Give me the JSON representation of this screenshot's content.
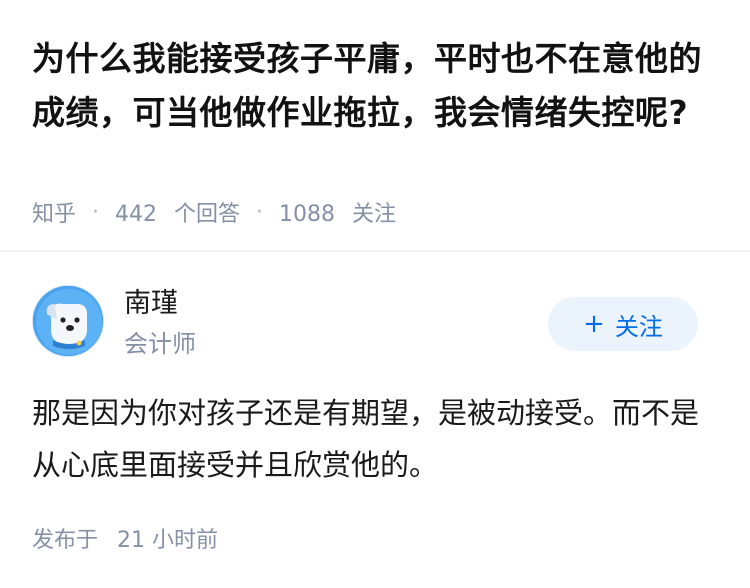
{
  "question": {
    "title": "为什么我能接受孩子平庸，平时也不在意他的成绩，可当他做作业拖拉，我会情绪失控呢?",
    "source": "知乎",
    "answers_count": "442",
    "answers_unit": "个回答",
    "followers_count": "1088",
    "followers_unit": "关注"
  },
  "answer": {
    "author_name": "南瑾",
    "author_title": "会计师",
    "follow_label": "关注",
    "follow_icon": "plus-icon",
    "content": "那是因为你对孩子还是有期望，是被动接受。而不是从心底里面接受并且欣赏他的。",
    "published_label": "发布于",
    "published_time": "21 小时前"
  },
  "colors": {
    "accent": "#056de8",
    "accent_bg": "#ebf3fc",
    "meta_text": "#8590a6",
    "avatar_bg": "#4aa3f0"
  }
}
